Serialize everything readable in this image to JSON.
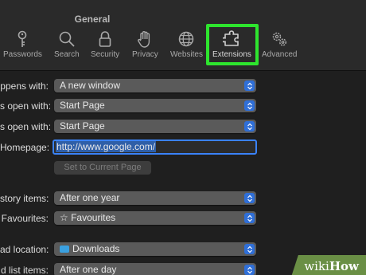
{
  "window": {
    "title": "General"
  },
  "tabs": [
    {
      "id": "passwords",
      "label": "Passwords",
      "icon": "key-icon"
    },
    {
      "id": "search",
      "label": "Search",
      "icon": "search-icon"
    },
    {
      "id": "security",
      "label": "Security",
      "icon": "lock-icon"
    },
    {
      "id": "privacy",
      "label": "Privacy",
      "icon": "hand-icon"
    },
    {
      "id": "websites",
      "label": "Websites",
      "icon": "globe-icon"
    },
    {
      "id": "extensions",
      "label": "Extensions",
      "icon": "puzzle-icon",
      "active": true
    },
    {
      "id": "advanced",
      "label": "Advanced",
      "icon": "gears-icon"
    }
  ],
  "highlight_color": "#2ee52e",
  "accent_color": "#2f6fd8",
  "settings": {
    "opens_with": {
      "label": "ppens with:",
      "value": "A new window"
    },
    "new_windows_open_with": {
      "label": "s open with:",
      "value": "Start Page"
    },
    "new_tabs_open_with": {
      "label": "s open with:",
      "value": "Start Page"
    },
    "homepage": {
      "label": "Homepage:",
      "value": "http://www.google.com/"
    },
    "set_current_page": {
      "label": "Set to Current Page"
    },
    "remove_history": {
      "label": "story items:",
      "value": "After one year"
    },
    "favourites_shows": {
      "label": "Favourites:",
      "value": "☆ Favourites"
    },
    "download_location": {
      "label": "ad location:",
      "value": "Downloads"
    },
    "remove_download_list": {
      "label": "d list items:",
      "value": "After one day"
    }
  },
  "watermark": {
    "prefix": "wiki",
    "suffix": "How"
  }
}
